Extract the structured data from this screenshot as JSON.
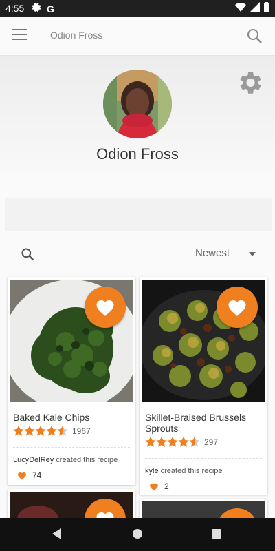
{
  "status": {
    "time": "4:55",
    "g_letter": "G",
    "icons_left": [
      "gear-icon",
      "google-g-icon"
    ],
    "icons_right": [
      "wifi-icon",
      "signal-icon",
      "battery-icon"
    ]
  },
  "appbar": {
    "title": "Odion Fross",
    "menu_icon": "menu-icon",
    "search_icon": "search-icon"
  },
  "profile": {
    "name": "Odion Fross",
    "settings_icon": "gear-icon"
  },
  "input": {
    "value": "",
    "placeholder": ""
  },
  "filter": {
    "sort_value": "Newest",
    "search_icon": "search-icon"
  },
  "accent": "#f07f1f",
  "cards": [
    {
      "title": "Baked Kale Chips",
      "rating": 4.5,
      "rating_count": "1967",
      "creator_name": "LucyDelRey",
      "creator_suffix": " created this recipe",
      "likes": "74",
      "favorite": true
    },
    {
      "title": "Skillet-Braised Brussels Sprouts",
      "rating": 4.5,
      "rating_count": "297",
      "creator_name": "kyle",
      "creator_suffix": " created this recipe",
      "likes": "2",
      "favorite": true
    },
    {
      "title": "",
      "favorite": true
    },
    {
      "title": "",
      "favorite": true
    }
  ]
}
